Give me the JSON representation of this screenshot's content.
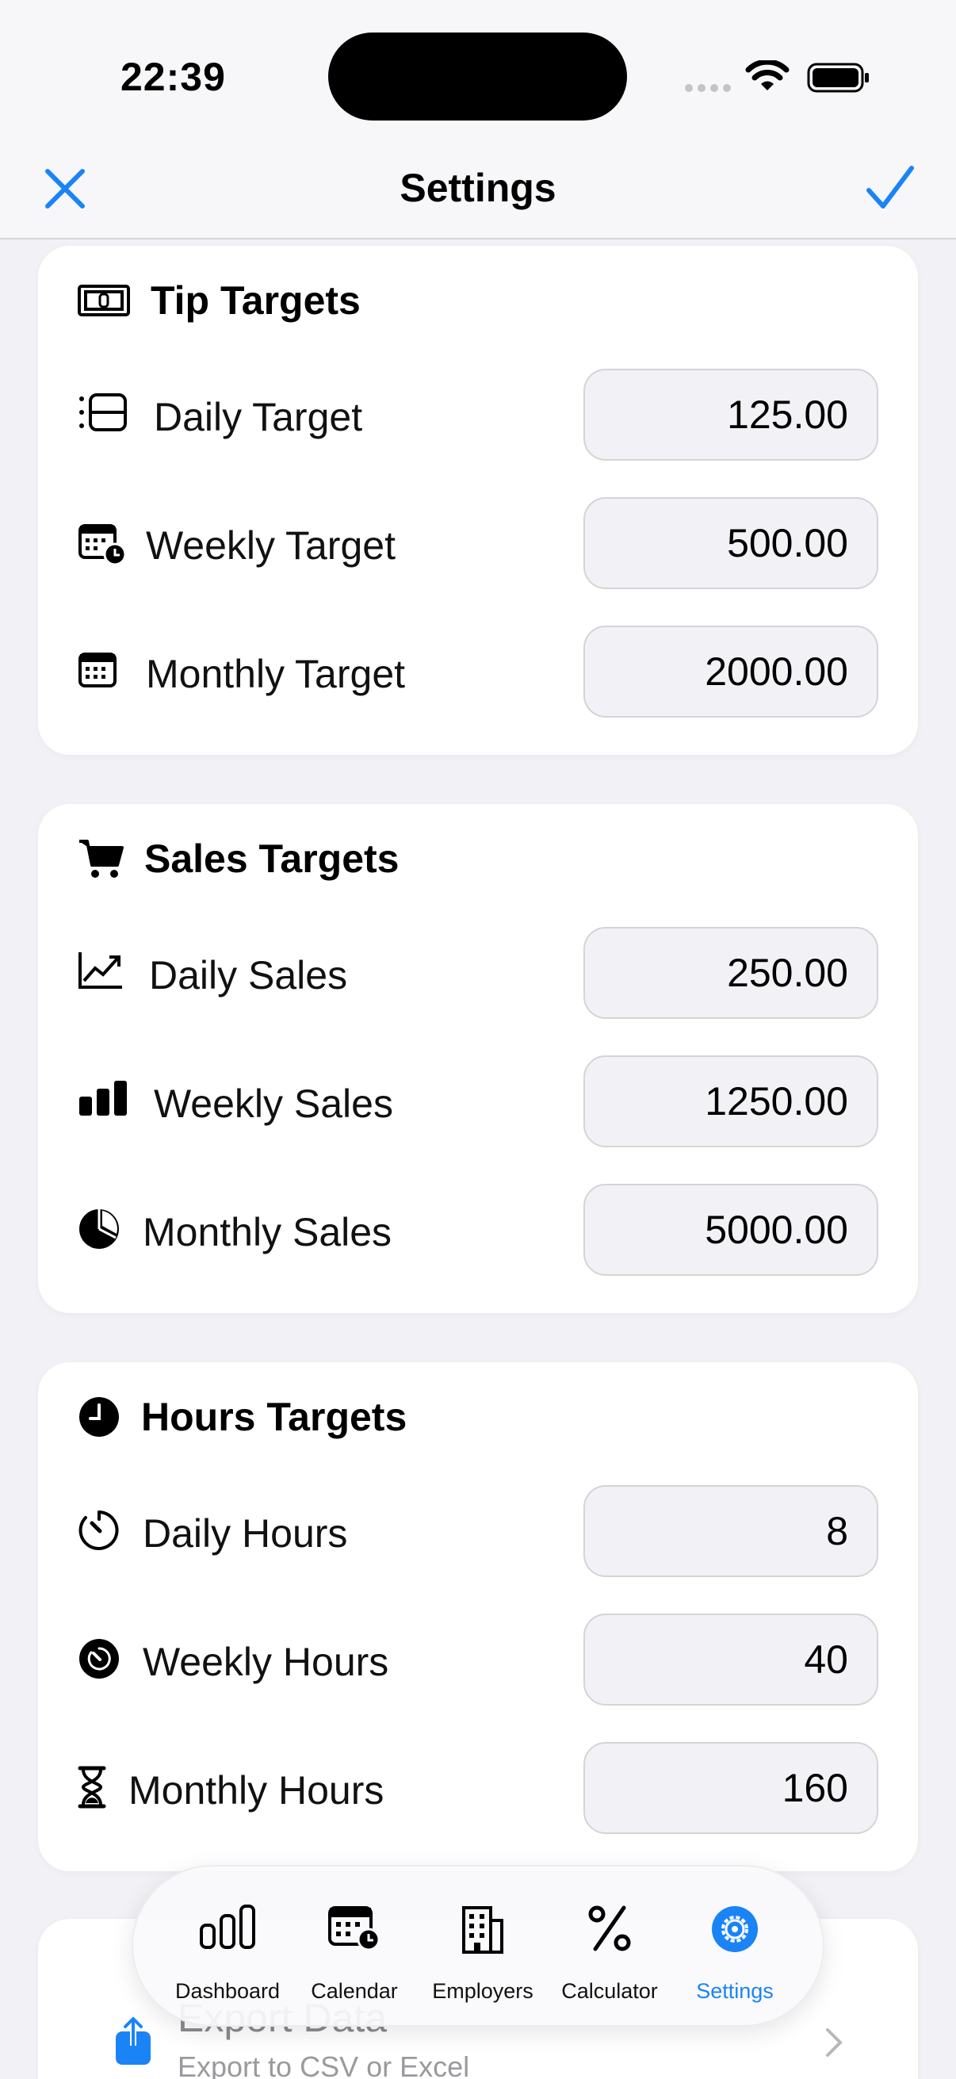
{
  "status": {
    "time": "22:39"
  },
  "nav": {
    "title": "Settings"
  },
  "tip": {
    "title": "Tip Targets",
    "rows": [
      {
        "label": "Daily Target",
        "value": "125.00"
      },
      {
        "label": "Weekly Target",
        "value": "500.00"
      },
      {
        "label": "Monthly Target",
        "value": "2000.00"
      }
    ]
  },
  "sales": {
    "title": "Sales Targets",
    "rows": [
      {
        "label": "Daily Sales",
        "value": "250.00"
      },
      {
        "label": "Weekly Sales",
        "value": "1250.00"
      },
      {
        "label": "Monthly Sales",
        "value": "5000.00"
      }
    ]
  },
  "hours": {
    "title": "Hours Targets",
    "rows": [
      {
        "label": "Daily Hours",
        "value": "8"
      },
      {
        "label": "Weekly Hours",
        "value": "40"
      },
      {
        "label": "Monthly Hours",
        "value": "160"
      }
    ]
  },
  "export": {
    "title": "Export Data",
    "subtitle": "Export to CSV or Excel"
  },
  "tabs": [
    {
      "label": "Dashboard",
      "icon": "bar-chart-icon"
    },
    {
      "label": "Calendar",
      "icon": "calendar-icon"
    },
    {
      "label": "Employers",
      "icon": "building-icon"
    },
    {
      "label": "Calculator",
      "icon": "percent-icon"
    },
    {
      "label": "Settings",
      "icon": "gear-icon",
      "active": true
    }
  ],
  "colors": {
    "accent": "#1a84f7",
    "background": "#f2f2f6",
    "card": "#ffffff"
  }
}
